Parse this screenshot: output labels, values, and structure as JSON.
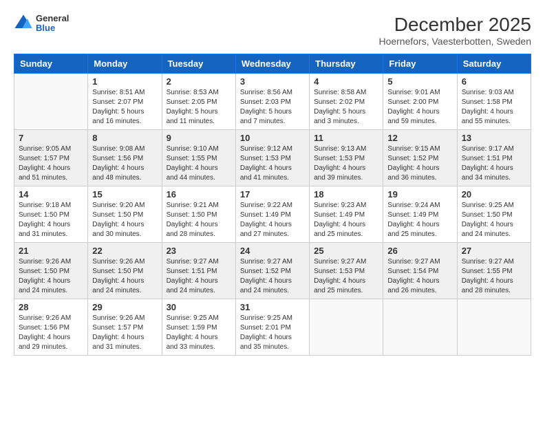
{
  "header": {
    "logo_general": "General",
    "logo_blue": "Blue",
    "title": "December 2025",
    "subtitle": "Hoernefors, Vaesterbotten, Sweden"
  },
  "days_of_week": [
    "Sunday",
    "Monday",
    "Tuesday",
    "Wednesday",
    "Thursday",
    "Friday",
    "Saturday"
  ],
  "weeks": [
    [
      {
        "day": "",
        "info": ""
      },
      {
        "day": "1",
        "info": "Sunrise: 8:51 AM\nSunset: 2:07 PM\nDaylight: 5 hours\nand 16 minutes."
      },
      {
        "day": "2",
        "info": "Sunrise: 8:53 AM\nSunset: 2:05 PM\nDaylight: 5 hours\nand 11 minutes."
      },
      {
        "day": "3",
        "info": "Sunrise: 8:56 AM\nSunset: 2:03 PM\nDaylight: 5 hours\nand 7 minutes."
      },
      {
        "day": "4",
        "info": "Sunrise: 8:58 AM\nSunset: 2:02 PM\nDaylight: 5 hours\nand 3 minutes."
      },
      {
        "day": "5",
        "info": "Sunrise: 9:01 AM\nSunset: 2:00 PM\nDaylight: 4 hours\nand 59 minutes."
      },
      {
        "day": "6",
        "info": "Sunrise: 9:03 AM\nSunset: 1:58 PM\nDaylight: 4 hours\nand 55 minutes."
      }
    ],
    [
      {
        "day": "7",
        "info": "Sunrise: 9:05 AM\nSunset: 1:57 PM\nDaylight: 4 hours\nand 51 minutes."
      },
      {
        "day": "8",
        "info": "Sunrise: 9:08 AM\nSunset: 1:56 PM\nDaylight: 4 hours\nand 48 minutes."
      },
      {
        "day": "9",
        "info": "Sunrise: 9:10 AM\nSunset: 1:55 PM\nDaylight: 4 hours\nand 44 minutes."
      },
      {
        "day": "10",
        "info": "Sunrise: 9:12 AM\nSunset: 1:53 PM\nDaylight: 4 hours\nand 41 minutes."
      },
      {
        "day": "11",
        "info": "Sunrise: 9:13 AM\nSunset: 1:53 PM\nDaylight: 4 hours\nand 39 minutes."
      },
      {
        "day": "12",
        "info": "Sunrise: 9:15 AM\nSunset: 1:52 PM\nDaylight: 4 hours\nand 36 minutes."
      },
      {
        "day": "13",
        "info": "Sunrise: 9:17 AM\nSunset: 1:51 PM\nDaylight: 4 hours\nand 34 minutes."
      }
    ],
    [
      {
        "day": "14",
        "info": "Sunrise: 9:18 AM\nSunset: 1:50 PM\nDaylight: 4 hours\nand 31 minutes."
      },
      {
        "day": "15",
        "info": "Sunrise: 9:20 AM\nSunset: 1:50 PM\nDaylight: 4 hours\nand 30 minutes."
      },
      {
        "day": "16",
        "info": "Sunrise: 9:21 AM\nSunset: 1:50 PM\nDaylight: 4 hours\nand 28 minutes."
      },
      {
        "day": "17",
        "info": "Sunrise: 9:22 AM\nSunset: 1:49 PM\nDaylight: 4 hours\nand 27 minutes."
      },
      {
        "day": "18",
        "info": "Sunrise: 9:23 AM\nSunset: 1:49 PM\nDaylight: 4 hours\nand 25 minutes."
      },
      {
        "day": "19",
        "info": "Sunrise: 9:24 AM\nSunset: 1:49 PM\nDaylight: 4 hours\nand 25 minutes."
      },
      {
        "day": "20",
        "info": "Sunrise: 9:25 AM\nSunset: 1:50 PM\nDaylight: 4 hours\nand 24 minutes."
      }
    ],
    [
      {
        "day": "21",
        "info": "Sunrise: 9:26 AM\nSunset: 1:50 PM\nDaylight: 4 hours\nand 24 minutes."
      },
      {
        "day": "22",
        "info": "Sunrise: 9:26 AM\nSunset: 1:50 PM\nDaylight: 4 hours\nand 24 minutes."
      },
      {
        "day": "23",
        "info": "Sunrise: 9:27 AM\nSunset: 1:51 PM\nDaylight: 4 hours\nand 24 minutes."
      },
      {
        "day": "24",
        "info": "Sunrise: 9:27 AM\nSunset: 1:52 PM\nDaylight: 4 hours\nand 24 minutes."
      },
      {
        "day": "25",
        "info": "Sunrise: 9:27 AM\nSunset: 1:53 PM\nDaylight: 4 hours\nand 25 minutes."
      },
      {
        "day": "26",
        "info": "Sunrise: 9:27 AM\nSunset: 1:54 PM\nDaylight: 4 hours\nand 26 minutes."
      },
      {
        "day": "27",
        "info": "Sunrise: 9:27 AM\nSunset: 1:55 PM\nDaylight: 4 hours\nand 28 minutes."
      }
    ],
    [
      {
        "day": "28",
        "info": "Sunrise: 9:26 AM\nSunset: 1:56 PM\nDaylight: 4 hours\nand 29 minutes."
      },
      {
        "day": "29",
        "info": "Sunrise: 9:26 AM\nSunset: 1:57 PM\nDaylight: 4 hours\nand 31 minutes."
      },
      {
        "day": "30",
        "info": "Sunrise: 9:25 AM\nSunset: 1:59 PM\nDaylight: 4 hours\nand 33 minutes."
      },
      {
        "day": "31",
        "info": "Sunrise: 9:25 AM\nSunset: 2:01 PM\nDaylight: 4 hours\nand 35 minutes."
      },
      {
        "day": "",
        "info": ""
      },
      {
        "day": "",
        "info": ""
      },
      {
        "day": "",
        "info": ""
      }
    ]
  ]
}
